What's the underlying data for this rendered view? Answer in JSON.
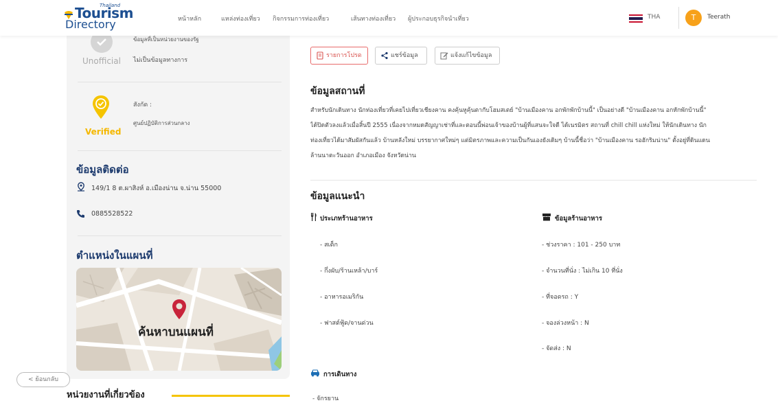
{
  "header": {
    "logo_top": "Thailand",
    "logo_line1": "Tourism",
    "logo_line2": "Directory",
    "nav": [
      "หน้าหลัก",
      "แหล่งท่องเที่ยว",
      "กิจกรรมการท่องเที่ยว",
      "เส้นทางท่องเที่ยว",
      "ผู้ประกอบธุรกิจนำเที่ยว"
    ],
    "lang": "THA",
    "user_initial": "T",
    "user_name": "Teerath"
  },
  "sidebar": {
    "unofficial_note": "ข้อมูลที่เป็นหน่วยงานของรัฐ",
    "unofficial_text": "ไม่เป็นข้อมูลทางการ",
    "unofficial_label": "Unofficial",
    "verified_affil": "สังกัด :",
    "verified_org": "ศูนย์ปฏิบัติการส่วนกลาง",
    "verified_label": "Verified",
    "contact_title": "ข้อมูลติดต่อ",
    "address": "149/1 8 ต.ผาสิงห์ อ.เมืองน่าน จ.น่าน 55000",
    "phone": "0885528522",
    "map_title": "ตำแหน่งในแผนที่",
    "map_label": "ค้นหาบนแผนที่",
    "back": "< ย้อนกลับ",
    "related_title": "หน่วยงานที่เกี่ยวข้อง"
  },
  "actions": {
    "report": "รายการโปรด",
    "share": "แชร์ข้อมูล",
    "edit": "แจ้งแก้ไขข้อมูล"
  },
  "main": {
    "info_title": "ข้อมูลสถานที่",
    "description": [
      "สำหรับนักเดินทาง นักท่องเที่ยวที่เคยไปเที่ยวเชียงคาน คงคุ้นหูคุ้นตากับโฮมสเตย์ \"บ้านเมืองคาน อกพักพักบ้านนี้\" เป็นอย่างดี \"บ้านเมืองคาน อกหักพักบ้านนี้\"",
      "ได้ปิดตัวลงแล้วเมื่อสิ้นปี 2555 เนื่องจากหมดสัญญาเช่าที่และตอนนี้พ่อนเจ้าของบ้านผู้ที่แสนจะใจดี ได้เนรมิตร สถานที่ chill chill แห่งใหม่ ให้นักเดินทาง นัก",
      "ท่องเที่ยวได้มาสัมผัสกันแล้ว บ้านหลังใหม่ บรรยากาศใหม่ๆ แต่มิตรภาพและความเป็นกันเองยังเดิมๆ บ้านนี้ชื่อว่า \"บ้านเมืองคาน รอฮักริมน่าน\" ตั้งอยู่ที่ดินแดน",
      "ล้านนาตะวันออก อำเภอเมือง จังหวัดน่าน"
    ],
    "recommend_title": "ข้อมูลแนะนำ",
    "restaurant_type_title": "ประเภทร้านอาหาร",
    "restaurant_types": [
      "- สเต็ก",
      "- กึ่งผับ/ร้านเหล้า/บาร์",
      "- อาหารอเมริกัน",
      "- ฟาสต์ฟู้ด/จานด่วน"
    ],
    "restaurant_info_title": "ข้อมูลร้านอาหาร",
    "restaurant_info": [
      "- ช่วงราคา : 101 - 250 บาท",
      "- จำนวนที่นั่ง : ไม่เกิน 10 ที่นั่ง",
      "- ที่จอดรถ : Y",
      "- จองล่วงหน้า : N",
      "- จัดส่ง : N"
    ],
    "travel_title": "การเดินทาง",
    "travel": [
      "- จักรยาน"
    ]
  },
  "colors": {
    "navy": "#1d3b6e",
    "accent": "#f7a11a",
    "verified": "#f5b800",
    "report_red": "#d9534f"
  }
}
